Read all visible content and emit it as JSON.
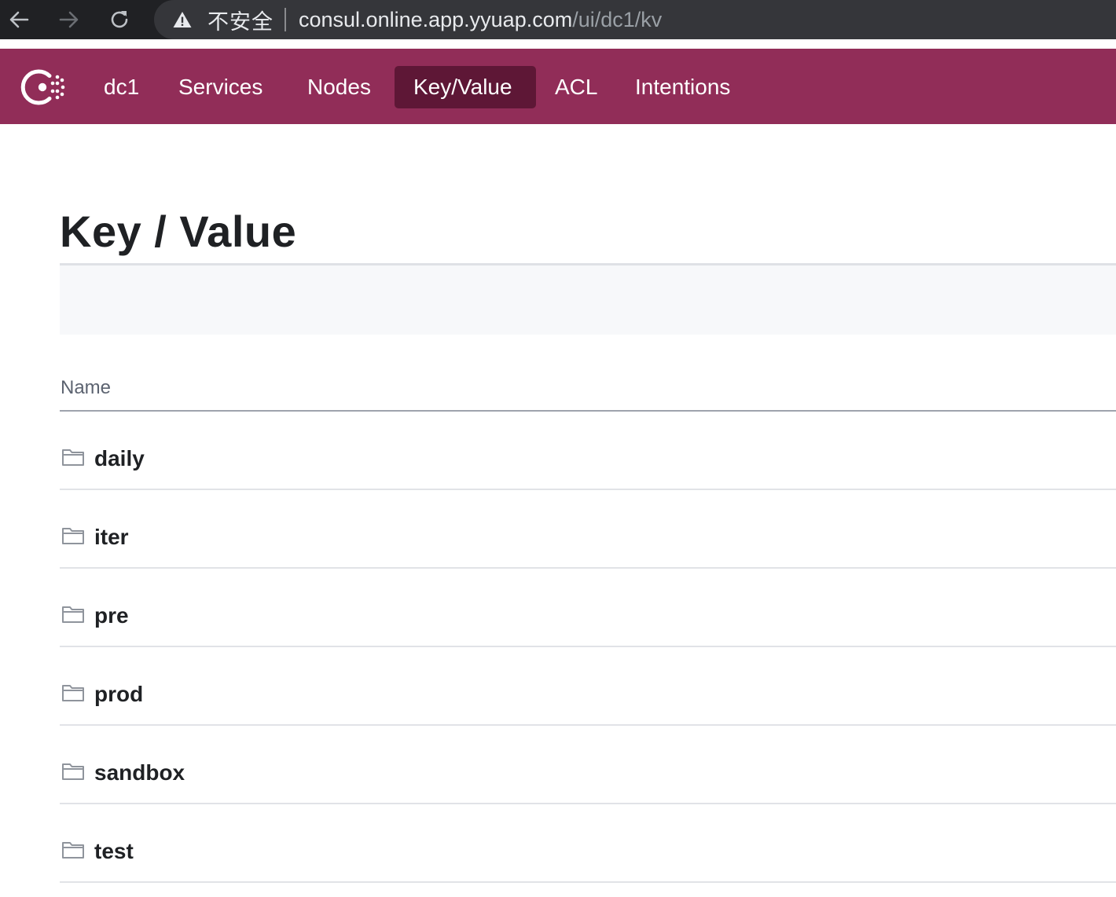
{
  "browser": {
    "security_label": "不安全",
    "url_host": "consul.online.app.yyuap.com",
    "url_path": "/ui/dc1/kv"
  },
  "header": {
    "nav": [
      {
        "label": "dc1"
      },
      {
        "label": "Services"
      },
      {
        "label": "Nodes"
      },
      {
        "label": "Key/Value",
        "active": true
      },
      {
        "label": "ACL"
      },
      {
        "label": "Intentions"
      }
    ],
    "colors": {
      "brand": "#912d58",
      "active_item": "#5e1736"
    }
  },
  "page": {
    "title": "Key / Value",
    "column_header": "Name",
    "rows": [
      {
        "name": "daily",
        "icon": "folder-icon"
      },
      {
        "name": "iter",
        "icon": "folder-icon"
      },
      {
        "name": "pre",
        "icon": "folder-icon"
      },
      {
        "name": "prod",
        "icon": "folder-icon"
      },
      {
        "name": "sandbox",
        "icon": "folder-icon"
      },
      {
        "name": "test",
        "icon": "folder-icon"
      }
    ]
  }
}
